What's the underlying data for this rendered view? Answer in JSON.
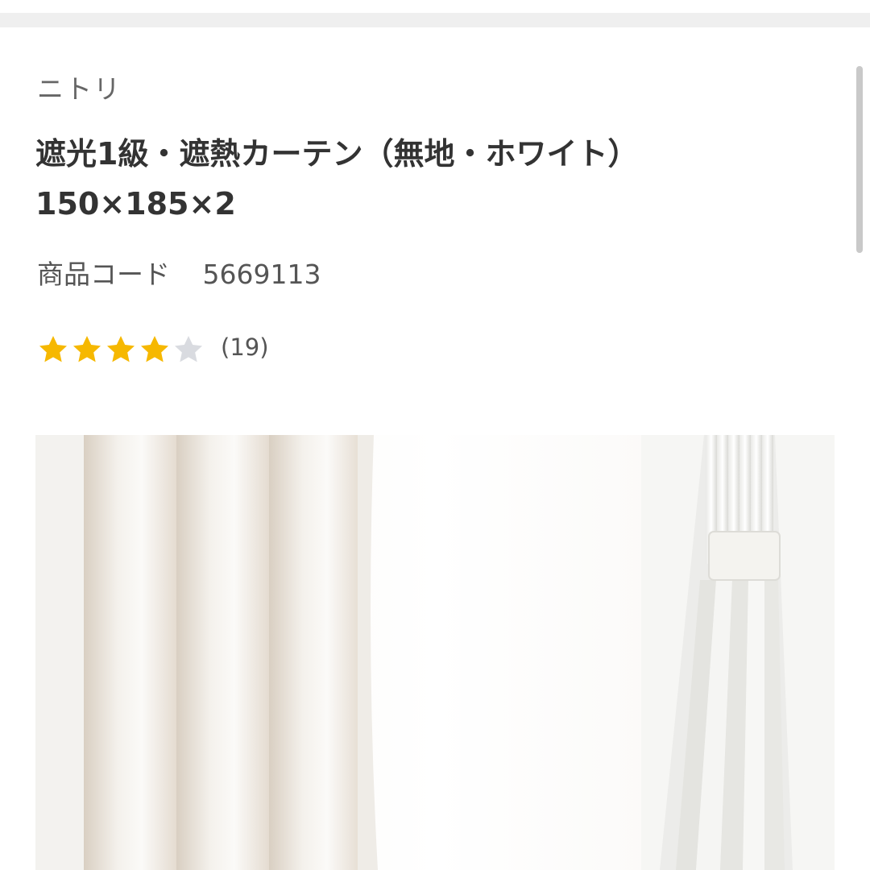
{
  "brand": "ニトリ",
  "product": {
    "title_line1": "遮光1級・遮熱カーテン（無地・ホワイト）",
    "title_line2": "150×185×2",
    "code_label": "商品コード",
    "code_value": "5669113"
  },
  "rating": {
    "score": 4,
    "max": 5,
    "review_count": "(19)",
    "star_color": "#f6b800",
    "empty_star_color": "#d9dbe0"
  },
  "image": {
    "description_icon": "curtain-photo"
  },
  "colors": {
    "text_primary": "#333333",
    "text_secondary": "#666666"
  }
}
